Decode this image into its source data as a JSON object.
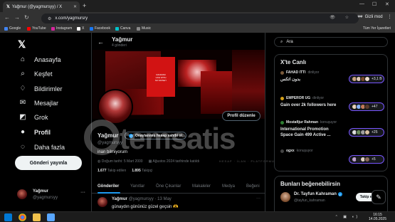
{
  "browser": {
    "tab_title": "Yağmur (@yagmursyy) / X",
    "url": "x.com/yagmursry",
    "incognito_label": "Gizli mod",
    "bookmarks": [
      {
        "label": "Google",
        "color": "#4285f4"
      },
      {
        "label": "YouTube",
        "color": "#ff0000"
      },
      {
        "label": "Instagram",
        "color": "#d6249f"
      },
      {
        "label": "X",
        "color": "#ffffff"
      },
      {
        "label": "Facebook",
        "color": "#1877f2"
      },
      {
        "label": "Canva",
        "color": "#00c4cc"
      },
      {
        "label": "Music",
        "color": "#888888"
      }
    ],
    "bookmarks_right": "Tüm Yer İşaretleri"
  },
  "nav": {
    "items": [
      {
        "label": "Anasayfa",
        "icon": "home-icon"
      },
      {
        "label": "Keşfet",
        "icon": "search-icon"
      },
      {
        "label": "Bildirimler",
        "icon": "bell-icon"
      },
      {
        "label": "Mesajlar",
        "icon": "mail-icon"
      },
      {
        "label": "Grok",
        "icon": "grok-icon"
      },
      {
        "label": "Profil",
        "icon": "person-icon"
      },
      {
        "label": "Daha fazla",
        "icon": "more-circle-icon"
      }
    ],
    "post_button": "Gönderi yayınla",
    "account_name": "Yağmur",
    "account_handle": "@yagmursyy",
    "more_glyph": "···"
  },
  "header": {
    "name": "Yağmur",
    "post_count": "4 gönderi"
  },
  "profile": {
    "edit_button": "Profil düzenle",
    "name": "Yağmur",
    "verify_label": "Onaylanmış hesap sahibi ol",
    "handle": "@yagmursyy",
    "bio": "inan bilmiyorum",
    "birthdate": "Doğum tarihi: 5 Mart 2000",
    "joined": "Ağustos 2024 tarihinde katıldı",
    "following_count": "1.677",
    "following_label": "Takip edilen",
    "followers_count": "1.895",
    "followers_label": "Takipçi",
    "banner_text": "RANDOM\nLIFE WITH\nNO MONEY"
  },
  "tabs": [
    "Gönderiler",
    "Yanıtlar",
    "Öne Çıkanlar",
    "Makaleler",
    "Medya",
    "Beğeni"
  ],
  "post": {
    "name": "Yağmur",
    "meta": "@yagmursyy · 13 May",
    "text": "günaydın gününüz güzel geçsin 🫶",
    "more": "···"
  },
  "watermark": {
    "text": "temsatis",
    "sub": "HESAP · İLAN · PLATFORMU"
  },
  "right": {
    "search_placeholder": "Ara",
    "trends_title": "X'te Canlı",
    "spaces": [
      {
        "host": "FAHAD ITTI",
        "status": "dinliyor",
        "title": "بدون اتكس",
        "count": "+3,1 B",
        "dot_color": "#7a5a3a",
        "faces": [
          "#c9a27e",
          "#e0c9b5",
          "#7a4a2a",
          "#f0e0d0"
        ]
      },
      {
        "host": "EMPEROR UG",
        "status": "dinliyor",
        "title": "Gain over 2k followers here",
        "count": "+47",
        "dot_color": "#d4a017",
        "faces": [
          "#e8d2b8",
          "#8ab4f8",
          "#c27a5a",
          "#5a3a2a"
        ]
      },
      {
        "host": "Mostafijur Rahman",
        "status": "konuşuyor",
        "title": "International Promotion Space Gain 499 Active ...",
        "count": "+25",
        "dot_color": "#2e7d32",
        "faces": [
          "#dedede",
          "#6a8a5a",
          "#a0a0a0",
          "#d9c0a0"
        ]
      },
      {
        "host": "ogxx",
        "status": "konuşuyor",
        "title": "",
        "count": "+5",
        "dot_color": "#444444",
        "faces": [
          "#c0a0d0",
          "#222222",
          "#e0d0c0",
          "#8a6a5a"
        ]
      }
    ],
    "who_title": "Bunları beğenebilirsin",
    "who": {
      "name": "Dr. Tayfun Kahraman",
      "handle": "@tayfun_kahraman",
      "follow_label": "Takip et"
    }
  },
  "taskbar": {
    "time": "16:15",
    "date": "14.05.2025"
  },
  "colors": {
    "accent": "#1d9bf0",
    "space_border": "#7856ff"
  }
}
